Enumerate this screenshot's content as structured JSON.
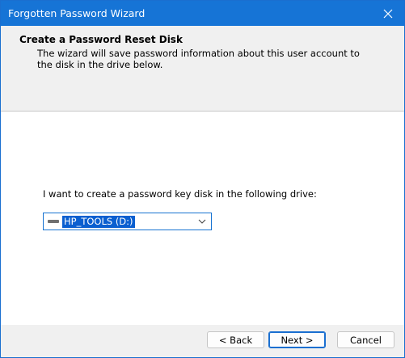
{
  "window": {
    "title": "Forgotten Password Wizard"
  },
  "header": {
    "title": "Create a Password Reset Disk",
    "subtitle": "The wizard will save password information about this user account to the disk in the drive below."
  },
  "main": {
    "prompt": "I want to create a password key disk in the following drive:",
    "drive_select": {
      "selected": "HP_TOOLS (D:)",
      "icon": "drive-icon"
    }
  },
  "footer": {
    "back_label": "< Back",
    "next_label": "Next >",
    "cancel_label": "Cancel"
  },
  "colors": {
    "titlebar": "#1674d6",
    "accent": "#0a5fd0"
  }
}
